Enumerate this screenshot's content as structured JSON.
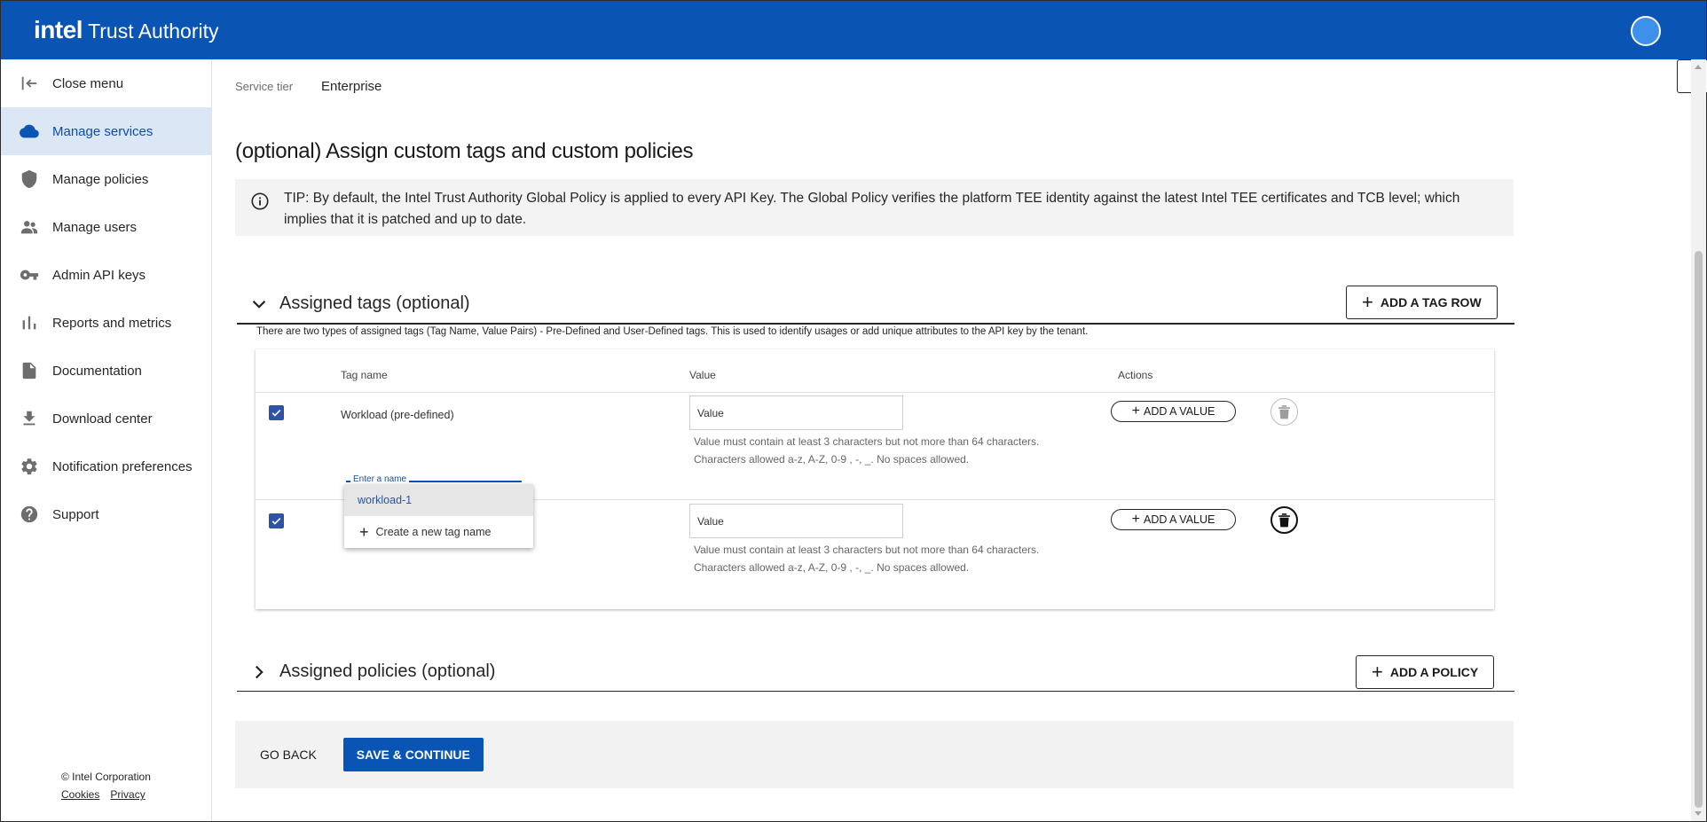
{
  "header": {
    "logo_brand": "intel",
    "logo_product": "Trust Authority"
  },
  "sidebar": {
    "items": [
      {
        "label": "Close menu",
        "icon": "close-menu-icon"
      },
      {
        "label": "Manage services",
        "icon": "cloud-icon",
        "active": true
      },
      {
        "label": "Manage policies",
        "icon": "shield-icon"
      },
      {
        "label": "Manage users",
        "icon": "users-icon"
      },
      {
        "label": "Admin API keys",
        "icon": "key-icon"
      },
      {
        "label": "Reports and metrics",
        "icon": "bar-chart-icon"
      },
      {
        "label": "Documentation",
        "icon": "document-icon"
      },
      {
        "label": "Download center",
        "icon": "download-icon"
      },
      {
        "label": "Notification preferences",
        "icon": "gear-icon"
      },
      {
        "label": "Support",
        "icon": "help-icon"
      }
    ],
    "footer": {
      "copyright": "© Intel Corporation",
      "cookies": "Cookies",
      "privacy": "Privacy"
    }
  },
  "main": {
    "service_tier_label": "Service tier",
    "service_tier_value": "Enterprise",
    "title": "(optional) Assign custom tags and custom policies",
    "tip": "TIP: By default, the Intel Trust Authority Global Policy is applied to every API Key. The Global Policy verifies the platform TEE identity against the latest Intel TEE certificates and TCB level; which implies that it is patched and up to date.",
    "tags_section": {
      "title": "Assigned tags (optional)",
      "add_button": "ADD A TAG ROW",
      "description": "There are two types of assigned tags (Tag Name, Value Pairs) - Pre-Defined and User-Defined tags. This is used to identify usages or add unique attributes to the API key by the tenant.",
      "columns": {
        "tag_name": "Tag name",
        "value": "Value",
        "actions": "Actions"
      },
      "rows": [
        {
          "checked": true,
          "tag_name": "Workload (pre-defined)",
          "value_placeholder": "Value",
          "helper_1": "Value must contain at least 3 characters but not more than 64 characters.",
          "helper_2": "Characters allowed a-z, A-Z, 0-9 , -, _. No spaces allowed.",
          "add_value": "ADD A VALUE",
          "delete_enabled": false
        },
        {
          "checked": true,
          "name_field_label": "Enter a name",
          "value_placeholder": "Value",
          "helper_1": "Value must contain at least 3 characters but not more than 64 characters.",
          "helper_2": "Characters allowed a-z, A-Z, 0-9 , -, _. No spaces allowed.",
          "add_value": "ADD A VALUE",
          "delete_enabled": true,
          "dropdown": {
            "options": [
              "workload-1"
            ],
            "create_label": "Create a new tag name"
          }
        }
      ]
    },
    "policies_section": {
      "title": "Assigned policies (optional)",
      "add_button": "ADD A POLICY"
    },
    "actions": {
      "back": "GO BACK",
      "save": "SAVE & CONTINUE"
    }
  },
  "colors": {
    "brand_blue": "#0a54b4",
    "active_nav_bg": "#dce7f6",
    "checkbox_blue": "#2f52a8"
  }
}
